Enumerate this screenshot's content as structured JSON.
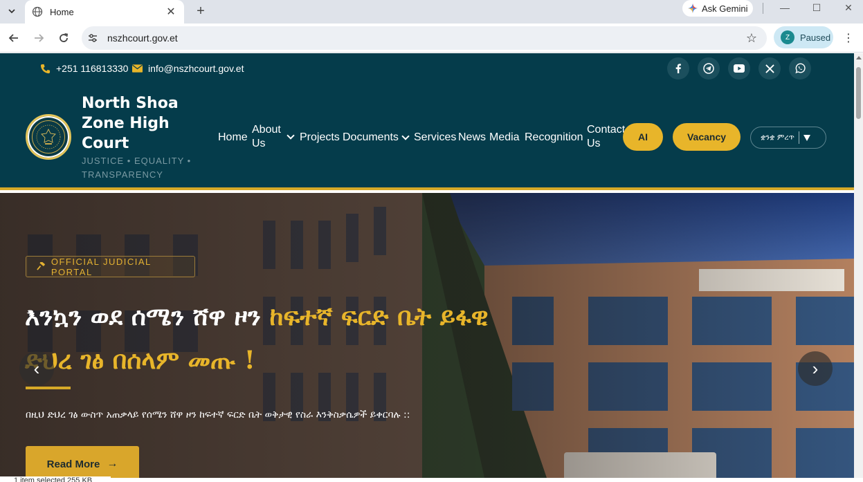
{
  "browser": {
    "tab_title": "Home",
    "new_tab_symbol": "+",
    "ask_gemini": "Ask Gemini",
    "url": "nszhcourt.gov.et",
    "profile_initial": "Z",
    "profile_status": "Paused"
  },
  "topbar": {
    "phone": "+251 116813330",
    "email": "info@nszhcourt.gov.et",
    "social_icons": [
      "facebook-icon",
      "telegram-icon",
      "youtube-icon",
      "x-icon",
      "whatsapp-icon"
    ]
  },
  "brand": {
    "title": "North Shoa Zone High Court",
    "tagline": "JUSTICE • EQUALITY • TRANSPARENCY"
  },
  "nav": {
    "home": "Home",
    "about": "About Us",
    "projects": "Projects",
    "documents": "Documents",
    "services": "Services",
    "news": "News",
    "media": "Media",
    "recognition": "Recognition",
    "contact": "Contact Us",
    "ai": "AI",
    "vacancy": "Vacancy",
    "language": "ቋንቋ ምረጥ"
  },
  "hero": {
    "badge": "OFFICIAL JUDICIAL PORTAL",
    "headline_white": "እንኳን ወደ ሰሜን ሸዋ ዞን ",
    "headline_gold": "ከፍተኛ ፍርድ ቤት ይፋዊ ድህረ ገፅ በሰላም መጡ !",
    "subtitle": "በዚህ ድህረ ገፅ ውስጥ አጠቃላይ የሰሜን ሸዋ ዞን ከፍተኛ ፍርድ ቤት ወቅታዊ የስራ እንቅስቃሴዎች ይቀርባሉ ::",
    "read_more": "Read More",
    "prev": "‹",
    "next": "›"
  },
  "status": {
    "text": "1 item selected  255 KB"
  },
  "colors": {
    "header_bg": "#053c4b",
    "accent_gold": "#e8b52a"
  }
}
